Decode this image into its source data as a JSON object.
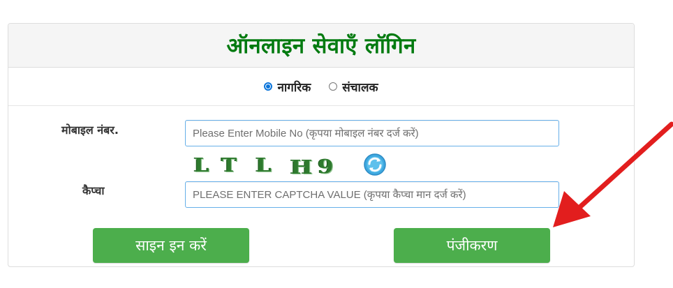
{
  "form": {
    "title": "ऑनलाइन सेवाएँ लॉगिन",
    "roles": [
      {
        "label": "नागरिक",
        "checked": true
      },
      {
        "label": "संचालक",
        "checked": false
      }
    ],
    "mobile": {
      "label": "मोबाइल नंबर.",
      "placeholder": "Please Enter Mobile No (कृपया मोबाइल नंबर दर्ज करें)",
      "value": ""
    },
    "captcha": {
      "image_text": [
        "L",
        "T",
        "L",
        "H",
        "9"
      ],
      "refresh_icon": "refresh-icon",
      "label": "कैप्चा",
      "placeholder": "PLEASE ENTER CAPTCHA VALUE (कृपया कैप्चा मान दर्ज करें)",
      "value": ""
    },
    "buttons": {
      "sign_in": "साइन इन करें",
      "register": "पंजीकरण"
    }
  },
  "annotation": {
    "arrow_color": "#e21e1e",
    "arrow_icon": "red-arrow-pointing-to-register-button"
  },
  "colors": {
    "title_green": "#007a0f",
    "button_green": "#4cae4c",
    "radio_blue": "#0a74da"
  }
}
